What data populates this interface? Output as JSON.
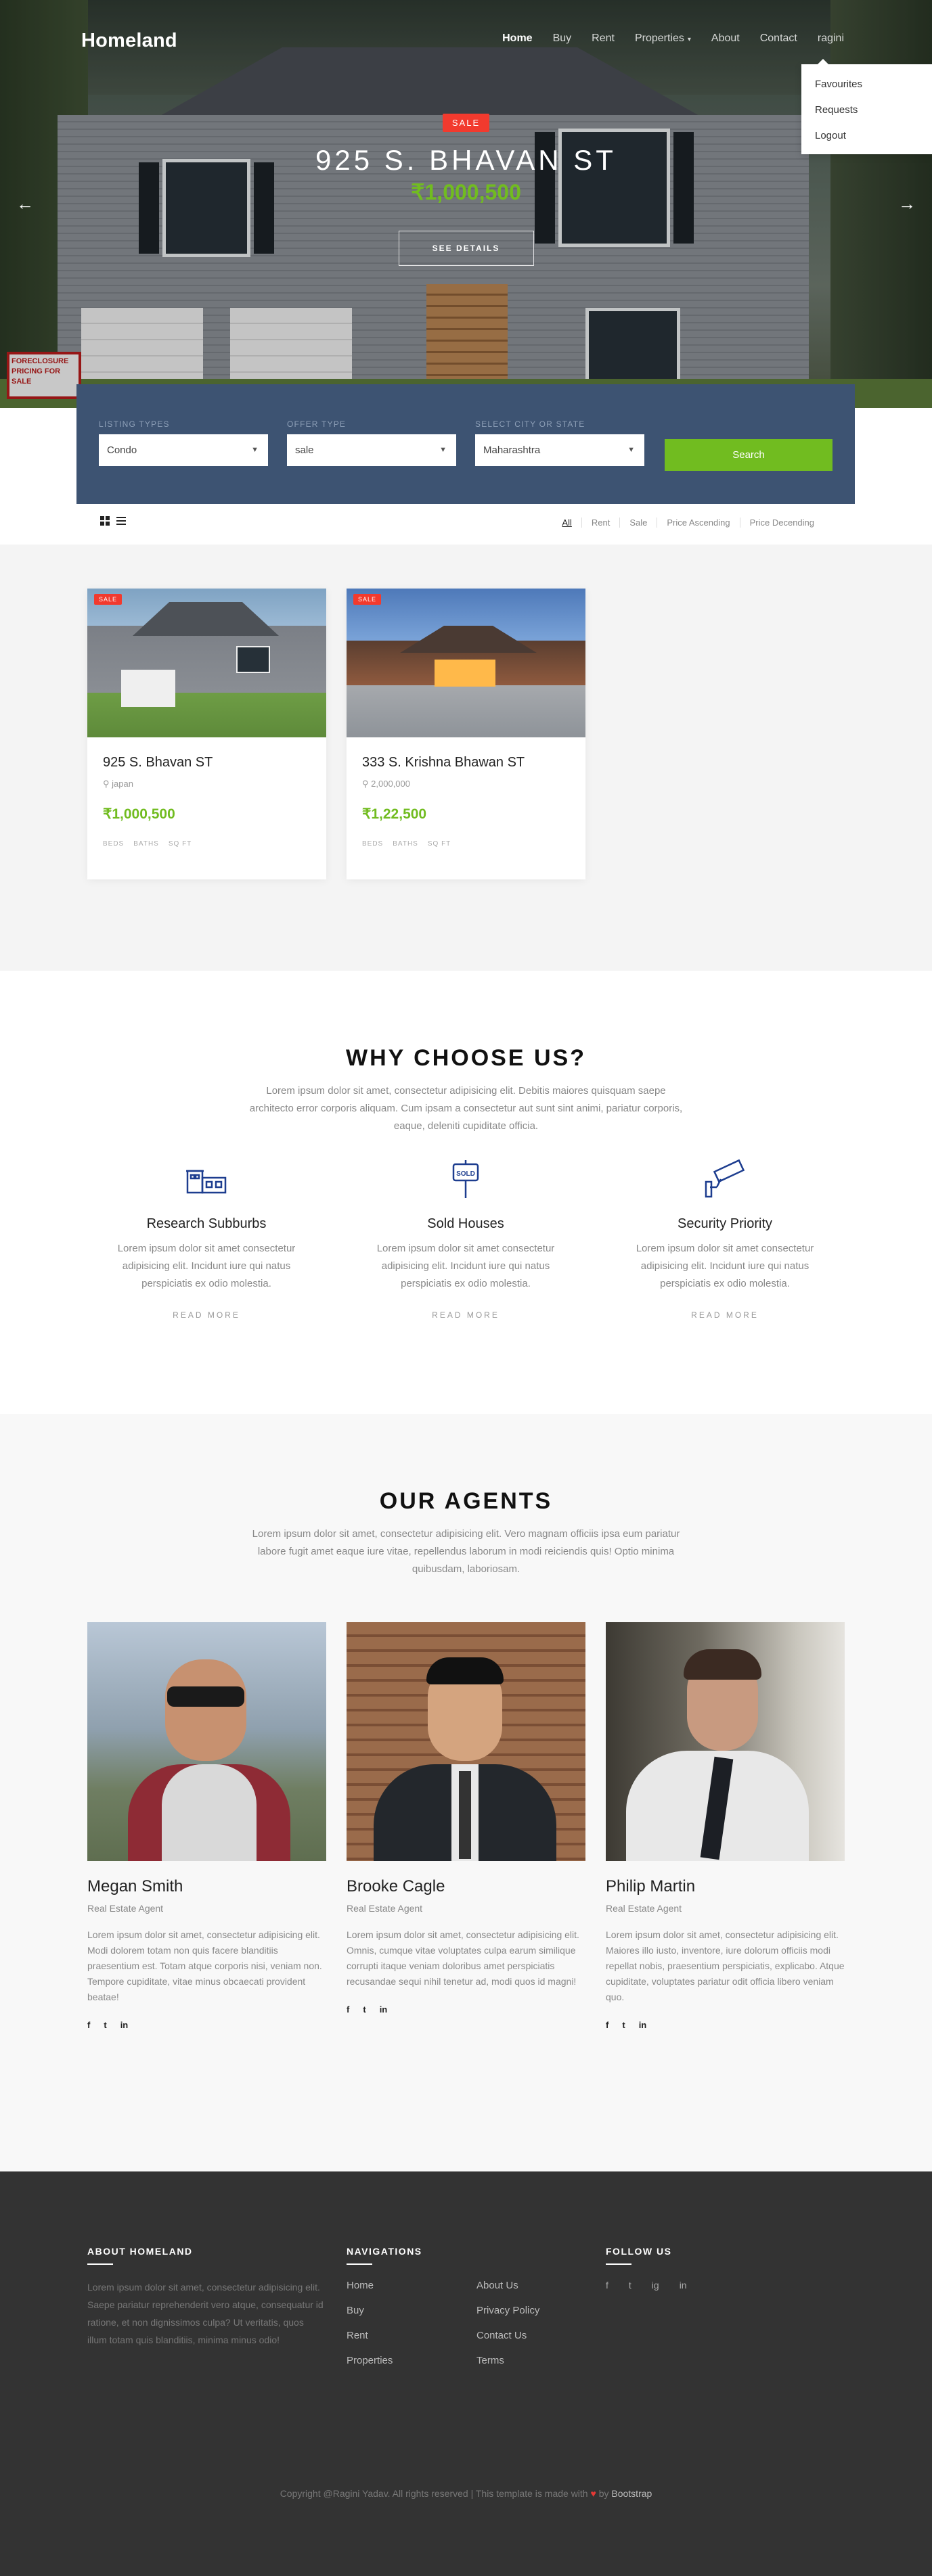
{
  "nav": {
    "logo": "Homeland",
    "items": [
      {
        "label": "Home"
      },
      {
        "label": "Buy"
      },
      {
        "label": "Rent"
      },
      {
        "label": "Properties",
        "caret": "▾"
      },
      {
        "label": "About"
      },
      {
        "label": "Contact"
      },
      {
        "label": "ragini"
      }
    ],
    "user_menu": [
      "Favourites",
      "Requests",
      "Logout"
    ]
  },
  "hero": {
    "badge": "SALE",
    "title": "925 S. BHAVAN ST",
    "price": "₹1,000,500",
    "button": "SEE DETAILS",
    "prev_arrow": "←",
    "next_arrow": "→",
    "sign_text": "FORECLOSURE PRICING FOR SALE"
  },
  "search": {
    "fields": [
      {
        "label": "LISTING TYPES",
        "value": "Condo"
      },
      {
        "label": "OFFER TYPE",
        "value": "sale"
      },
      {
        "label": "SELECT CITY OR STATE",
        "value": "Maharashtra"
      }
    ],
    "button": "Search"
  },
  "filters": [
    "All",
    "Rent",
    "Sale",
    "Price Ascending",
    "Price Decending"
  ],
  "listings": [
    {
      "badge": "SALE",
      "title": "925 S. Bhavan ST",
      "location": "japan",
      "price": "₹1,000,500",
      "specs": [
        "BEDS",
        "BATHS",
        "SQ FT"
      ]
    },
    {
      "badge": "SALE",
      "title": "333 S. Krishna Bhawan ST",
      "location": "2,000,000",
      "price": "₹1,22,500",
      "specs": [
        "BEDS",
        "BATHS",
        "SQ FT"
      ]
    }
  ],
  "why": {
    "title": "WHY CHOOSE US?",
    "desc": "Lorem ipsum dolor sit amet, consectetur adipisicing elit. Debitis maiores quisquam saepe architecto error corporis aliquam. Cum ipsam a consectetur aut sunt sint animi, pariatur corporis, eaque, deleniti cupiditate officia.",
    "features": [
      {
        "title": "Research Subburbs",
        "text": "Lorem ipsum dolor sit amet consectetur adipisicing elit. Incidunt iure qui natus perspiciatis ex odio molestia.",
        "link": "READ MORE",
        "icon": "house-icon"
      },
      {
        "title": "Sold Houses",
        "text": "Lorem ipsum dolor sit amet consectetur adipisicing elit. Incidunt iure qui natus perspiciatis ex odio molestia.",
        "link": "READ MORE",
        "icon": "sold-sign-icon",
        "icon_text": "SOLD"
      },
      {
        "title": "Security Priority",
        "text": "Lorem ipsum dolor sit amet consectetur adipisicing elit. Incidunt iure qui natus perspiciatis ex odio molestia.",
        "link": "READ MORE",
        "icon": "security-camera-icon"
      }
    ]
  },
  "agents_section": {
    "title": "OUR AGENTS",
    "desc": "Lorem ipsum dolor sit amet, consectetur adipisicing elit. Vero magnam officiis ipsa eum pariatur labore fugit amet eaque iure vitae, repellendus laborum in modi reiciendis quis! Optio minima quibusdam, laboriosam.",
    "agents": [
      {
        "name": "Megan Smith",
        "role": "Real Estate Agent",
        "bio": "Lorem ipsum dolor sit amet, consectetur adipisicing elit. Modi dolorem totam non quis facere blanditiis praesentium est. Totam atque corporis nisi, veniam non. Tempore cupiditate, vitae minus obcaecati provident beatae!"
      },
      {
        "name": "Brooke Cagle",
        "role": "Real Estate Agent",
        "bio": "Lorem ipsum dolor sit amet, consectetur adipisicing elit. Omnis, cumque vitae voluptates culpa earum similique corrupti itaque veniam doloribus amet perspiciatis recusandae sequi nihil tenetur ad, modi quos id magni!"
      },
      {
        "name": "Philip Martin",
        "role": "Real Estate Agent",
        "bio": "Lorem ipsum dolor sit amet, consectetur adipisicing elit. Maiores illo iusto, inventore, iure dolorum officiis modi repellat nobis, praesentium perspiciatis, explicabo. Atque cupiditate, voluptates pariatur odit officia libero veniam quo."
      }
    ],
    "social_icons": [
      "f",
      "t",
      "in"
    ]
  },
  "footer": {
    "about_head": "ABOUT HOMELAND",
    "about_text": "Lorem ipsum dolor sit amet, consectetur adipisicing elit. Saepe pariatur reprehenderit vero atque, consequatur id ratione, et non dignissimos culpa? Ut veritatis, quos illum totam quis blanditiis, minima minus odio!",
    "nav_head": "NAVIGATIONS",
    "nav_col1": [
      "Home",
      "Buy",
      "Rent",
      "Properties"
    ],
    "nav_col2": [
      "About Us",
      "Privacy Policy",
      "Contact Us",
      "Terms"
    ],
    "follow_head": "FOLLOW US",
    "follow_icons": [
      "f",
      "t",
      "ig",
      "in"
    ],
    "copyright_prefix": "Copyright @Ragini Yadav. All rights reserved | This template is made with",
    "heart": "♥",
    "by": "by",
    "brand": "Bootstrap"
  },
  "colors": {
    "accent_green": "#71bc20",
    "badge_red": "#f23a2e",
    "search_bg": "#3d5372",
    "footer_bg": "#333333"
  }
}
